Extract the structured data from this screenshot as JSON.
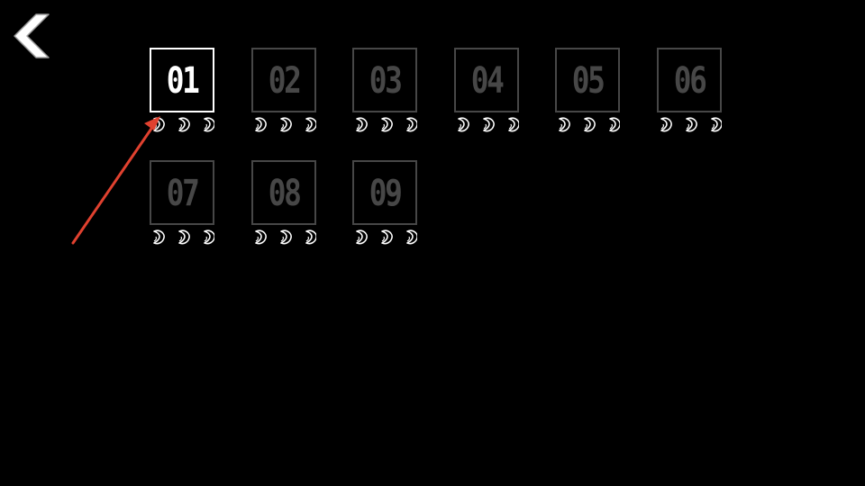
{
  "back": {
    "icon": "chevron-left-icon",
    "color": "#ffffff"
  },
  "levels": [
    {
      "label": "01",
      "unlocked": true,
      "stars": 0
    },
    {
      "label": "02",
      "unlocked": false,
      "stars": 0
    },
    {
      "label": "03",
      "unlocked": false,
      "stars": 0
    },
    {
      "label": "04",
      "unlocked": false,
      "stars": 0
    },
    {
      "label": "05",
      "unlocked": false,
      "stars": 0
    },
    {
      "label": "06",
      "unlocked": false,
      "stars": 0
    },
    {
      "label": "07",
      "unlocked": false,
      "stars": 0
    },
    {
      "label": "08",
      "unlocked": false,
      "stars": 0
    },
    {
      "label": "09",
      "unlocked": false,
      "stars": 0
    }
  ],
  "stars_per_level": 3,
  "colors": {
    "background": "#000000",
    "unlocked": "#ffffff",
    "locked": "#474747",
    "hint_arrow": "#e0412f"
  },
  "hint": {
    "icon": "pointer-arrow-icon",
    "target": "level-01"
  }
}
